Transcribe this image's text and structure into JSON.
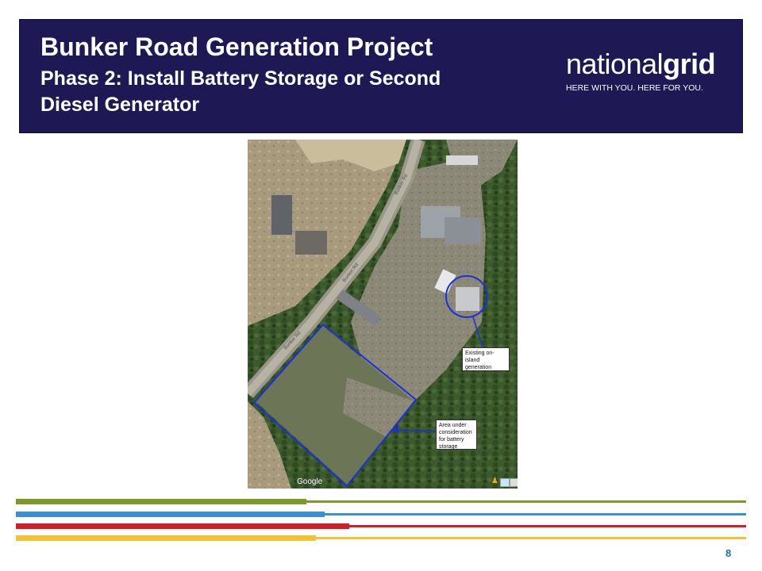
{
  "header": {
    "title": "Bunker Road Generation Project",
    "subtitle": "Phase 2: Install Battery Storage or Second Diesel Generator",
    "logo": {
      "word_light": "national",
      "word_bold": "grid",
      "tagline": "HERE WITH YOU. HERE FOR YOU."
    }
  },
  "map": {
    "road_labels": [
      "Bunker Rd",
      "Bunker Rd",
      "Bunker Rd"
    ],
    "callouts": {
      "existing_generation": "Existing on-island generation",
      "battery_area": "Area under consideration for battery storage"
    },
    "brand": "Google",
    "pegman_glyph": "♟"
  },
  "colors": {
    "header_bg": "#1e1855",
    "stripe_green": "#7b9a27",
    "stripe_blue": "#3b8fd6",
    "stripe_red": "#cf2027",
    "stripe_yellow": "#f2c230",
    "annotation_blue": "#1a2fe0",
    "page_number": "#1f72a9"
  },
  "footer": {
    "page_number": "8"
  }
}
